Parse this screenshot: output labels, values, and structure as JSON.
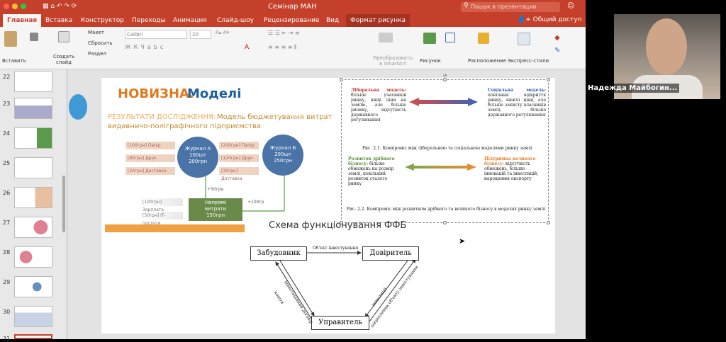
{
  "titlebar": {
    "title": "Семінар МАН",
    "search": "Пошук в презентации"
  },
  "tabs": [
    "Главная",
    "Вставка",
    "Конструктор",
    "Переходы",
    "Анимация",
    "Слайд-шоу",
    "Рецензирование",
    "Вид",
    "Формат рисунка"
  ],
  "share": "Общий доступ",
  "ribbon": {
    "paste": "Вставить",
    "create_slide": "Создать слайд",
    "layout": "Макет",
    "reset": "Сбросить",
    "section": "Раздел",
    "font": "Calibri",
    "size": "20",
    "convert": "Преобразовать в SmartArt",
    "picture": "Рисунок",
    "arrange": "Расположение",
    "styles": "Экспресс-стили"
  },
  "thumbs": [
    "22",
    "23",
    "24",
    "25",
    "26",
    "27",
    "28",
    "29",
    "30",
    "31"
  ],
  "slide": {
    "title_a": "НОВИЗНА.",
    "title_b": "Моделі",
    "subtitle_a": "РЕЗУЛЬТАТИ ДОСЛІДЖЕННЯ:",
    "subtitle_b": "Модель бюджетування витрат",
    "subtitle_c": "видавничо-поліграфічного підприємства",
    "pills_left": [
      "[100грн] Папір",
      "[80грн] Друк",
      "[20грн] Доставка"
    ],
    "pills_right": [
      "[200грн] Папір",
      "[120грн] Друк",
      "[30грн] Доставка"
    ],
    "pills_bottom": [
      "[100грн] Зарплата",
      "[50грн] IT-послуги"
    ],
    "journal_a": [
      "Журнал А",
      "100шт",
      "200грн"
    ],
    "journal_b": [
      "Журнал Б",
      "200шт",
      "250грн"
    ],
    "indirect": [
      "Непрямі",
      "витрати",
      "150грн"
    ],
    "plus50": "+50грн",
    "plus100": "+100гр",
    "lib_title": "Ліберальна модель:",
    "lib_text": "більше учасників ринку, вищі ціни на землю, але більше ризику, відсутність державного регулювання",
    "soc_title": "Соціальна модель:",
    "soc_text": "повтання відкриття ринку, нижчі ціни, але більше захисту власників землі, більше державного регулювання",
    "fig1": "Рис. 2.1. Компроміс між ліберальною та соціальною моделями ринку землі",
    "small_title": "Розвиток дрібного бізнесу:",
    "small_text": "більше обмежень на розмір землі, повільний розвиток сталого ринку",
    "big_title": "Підтримка великого бізнесу:",
    "big_text": "відсутність обмежень, більше інновацій та інвестицій, нарощення експорту",
    "fig2": "Рис. 2.2. Компроміс між розвитком дрібного та великого бізнесу  в моделях ринку землі",
    "scheme_title": "Схема функціонування ФФБ",
    "developer": "Забудовник",
    "trustee": "Довіритель",
    "manager": "Управитель",
    "arrow_top": "Об'єкт інвестування",
    "arrow_ld1": "Інвестиційний договір",
    "arrow_ld2": "кошти",
    "arrow_rd1": "інвестиції",
    "arrow_rd2": "закріплення об'єкту інвестування"
  },
  "video": {
    "name": "Надежда Майбогин..."
  }
}
